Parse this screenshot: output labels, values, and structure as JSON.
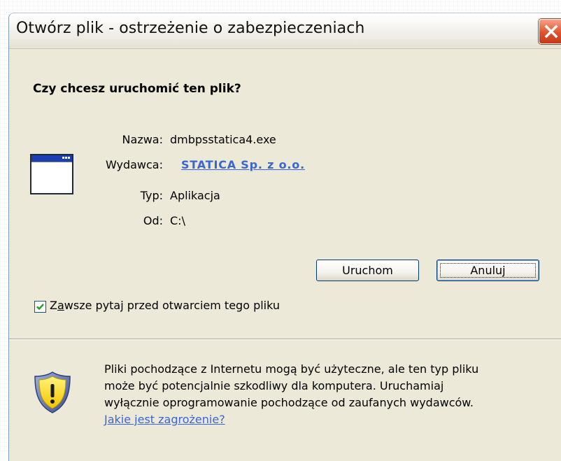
{
  "window": {
    "title": "Otwórz plik - ostrzeżenie o zabezpieczeniach"
  },
  "dialog": {
    "question": "Czy chcesz uruchomić ten plik?",
    "fields": {
      "name_label": "Nazwa:",
      "name_value": "dmbpsstatica4.exe",
      "publisher_label": "Wydawca:",
      "publisher_value": "STATICA Sp. z o.o.",
      "type_label": "Typ:",
      "type_value": "Aplikacja",
      "from_label": "Od:",
      "from_value": "C:\\"
    },
    "buttons": {
      "run": "Uruchom",
      "cancel": "Anuluj"
    },
    "checkbox": {
      "label_prefix": "Z",
      "label_underlined": "a",
      "label_rest": "wsze pytaj przed otwarciem tego pliku",
      "checked": true
    },
    "warning": {
      "line1": "Pliki pochodzące z Internetu mogą być użyteczne, ale ten typ pliku",
      "line2": "może być potencjalnie szkodliwy dla komputera. Uruchamiaj",
      "line3": "wyłącznie oprogramowanie pochodzące od zaufanych wydawców.",
      "link": "Jakie jest zagrożenie?"
    }
  },
  "icons": {
    "close": "close-icon",
    "app": "application-window-icon",
    "shield": "security-shield-warning-icon",
    "check": "checkmark-icon"
  },
  "colors": {
    "dialog_bg": "#ece9d8",
    "link": "#3a66d4",
    "close_button": "#e0522b",
    "button_border": "#003c74"
  }
}
